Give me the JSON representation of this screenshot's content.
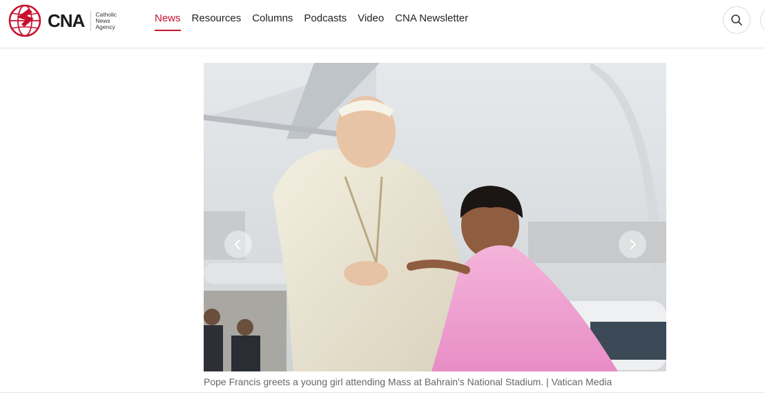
{
  "brand": {
    "logo_text": "CNA",
    "logo_subtitle": "Catholic News Agency",
    "accent_color": "#c8102e"
  },
  "nav": {
    "items": [
      {
        "label": "News",
        "active": true
      },
      {
        "label": "Resources",
        "active": false
      },
      {
        "label": "Columns",
        "active": false
      },
      {
        "label": "Podcasts",
        "active": false
      },
      {
        "label": "Video",
        "active": false
      },
      {
        "label": "CNA Newsletter",
        "active": false
      }
    ]
  },
  "header_actions": {
    "search_icon": "search-icon",
    "menu_icon": "menu-icon"
  },
  "carousel": {
    "prev_icon": "chevron-left-icon",
    "next_icon": "chevron-right-icon"
  },
  "article": {
    "caption": "Pope Francis greets a young girl attending Mass at Bahrain's National Stadium. | Vatican Media"
  }
}
